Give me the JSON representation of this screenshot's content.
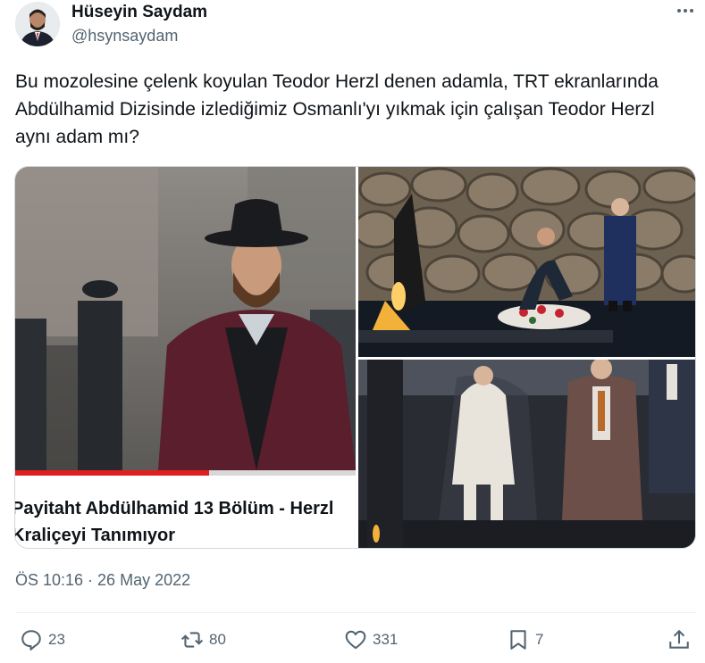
{
  "author": {
    "display_name": "Hüseyin Saydam",
    "handle": "@hsynsaydam"
  },
  "more_icon": "more-icon",
  "tweet": {
    "text": "Bu mozolesine çelenk koyulan Teodor Herzl denen adamla, TRT ekranlarında Abdülhamid Dizisinde izlediğimiz Osmanlı'yı yıkmak için çalışan Teodor Herzl aynı adam mı?",
    "timestamp": "ÖS 10:16 · 26 May 2022"
  },
  "media": {
    "video_card": {
      "title_line1": "Payitaht Abdülhamid 13 Bölüm - Herzl",
      "title_line2": "Kraliçeyi Tanımıyor",
      "progress": 0.57
    }
  },
  "actions": {
    "replies": {
      "icon": "reply-icon",
      "count": "23"
    },
    "retweets": {
      "icon": "retweet-icon",
      "count": "80"
    },
    "likes": {
      "icon": "like-icon",
      "count": "331"
    },
    "bookmarks": {
      "icon": "bookmark-icon",
      "count": "7"
    },
    "share": {
      "icon": "share-icon"
    }
  },
  "colors": {
    "text": "#0f1419",
    "secondary": "#536471",
    "border": "#cfd9de"
  }
}
